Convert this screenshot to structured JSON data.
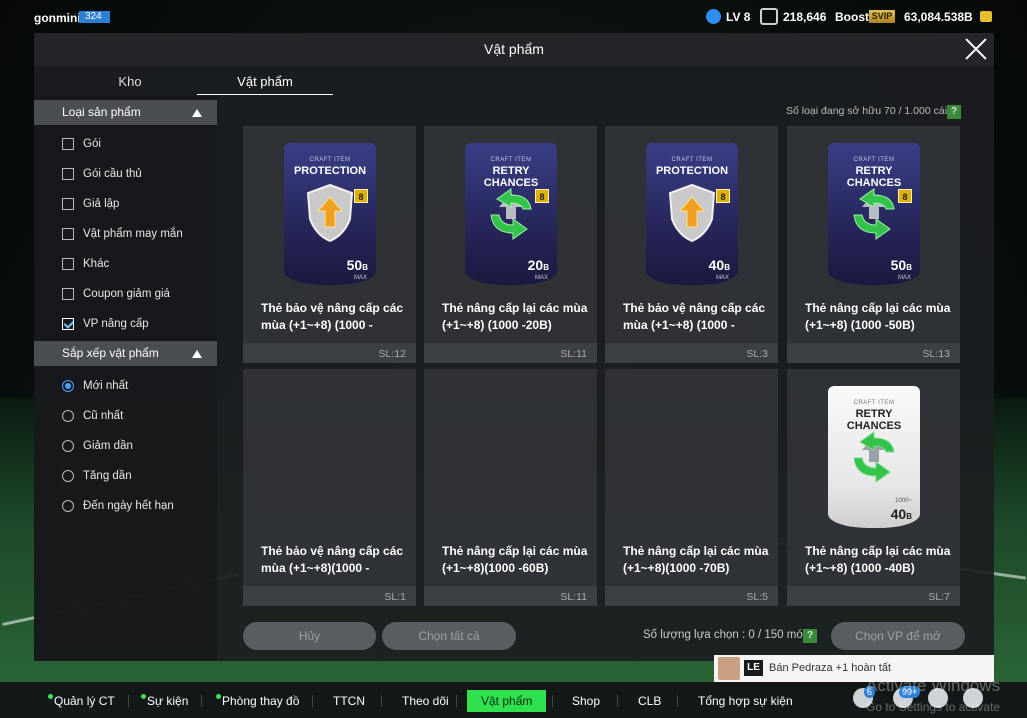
{
  "user": {
    "name": "gonmini",
    "badge": "324"
  },
  "status": {
    "level": "LV 8",
    "coins": "218,646",
    "boost_label": "Boost",
    "svip_label": "SVIP",
    "bp": "63,084.538B"
  },
  "modal": {
    "title": "Vật phẩm",
    "tabs": [
      {
        "label": "Kho"
      },
      {
        "label": "Vật phẩm"
      }
    ]
  },
  "sidebar": {
    "product_type": {
      "header": "Loại sản phẩm",
      "items": [
        {
          "label": "Gói",
          "checked": false
        },
        {
          "label": "Gói cầu thủ",
          "checked": false
        },
        {
          "label": "Giả lập",
          "checked": false
        },
        {
          "label": "Vật phẩm may mắn",
          "checked": false
        },
        {
          "label": "Khác",
          "checked": false
        },
        {
          "label": "Coupon giảm giá",
          "checked": false
        },
        {
          "label": "VP nâng cấp",
          "checked": true
        }
      ]
    },
    "sort": {
      "header": "Sắp xếp vật phẩm",
      "items": [
        {
          "label": "Mới nhất",
          "selected": true
        },
        {
          "label": "Cũ nhất",
          "selected": false
        },
        {
          "label": "Giảm dần",
          "selected": false
        },
        {
          "label": "Tăng dần",
          "selected": false
        },
        {
          "label": "Đến ngày hết hạn",
          "selected": false
        }
      ]
    }
  },
  "inventory": {
    "count_text": "Số loại đang sở hữu  70 / 1.000 cái",
    "help": "?"
  },
  "cards": [
    {
      "sub": "CRAFT ITEM",
      "title": "PROTECTION",
      "level": "8",
      "value": "50",
      "unit": "B",
      "max": "MAX",
      "name": "Thẻ bảo vệ nâng cấp các mùa (+1~+8) (1000 -",
      "sl": "SL:12",
      "style": "dark"
    },
    {
      "sub": "CRAFT ITEM",
      "title": "RETRY CHANCES",
      "level": "8",
      "value": "20",
      "unit": "B",
      "max": "MAX",
      "name": "Thẻ nâng cấp lại các mùa (+1~+8) (1000 -20B)",
      "sl": "SL:11",
      "style": "dark"
    },
    {
      "sub": "CRAFT ITEM",
      "title": "PROTECTION",
      "level": "8",
      "value": "40",
      "unit": "B",
      "max": "MAX",
      "name": "Thẻ bảo vệ nâng cấp các mùa (+1~+8) (1000 -",
      "sl": "SL:3",
      "style": "dark"
    },
    {
      "sub": "CRAFT ITEM",
      "title": "RETRY CHANCES",
      "level": "8",
      "value": "50",
      "unit": "B",
      "max": "MAX",
      "name": "Thẻ nâng cấp lại các mùa (+1~+8) (1000 -50B)",
      "sl": "SL:13",
      "style": "dark"
    },
    {
      "name": "Thẻ bảo vệ nâng cấp các mùa (+1~+8)(1000 -",
      "sl": "SL:1",
      "style": "none"
    },
    {
      "name": "Thẻ nâng cấp lại các mùa (+1~+8)(1000 -60B)",
      "sl": "SL:11",
      "style": "none"
    },
    {
      "name": "Thẻ nâng cấp lại các mùa (+1~+8)(1000 -70B)",
      "sl": "SL:5",
      "style": "none"
    },
    {
      "sub": "CRAFT ITEM",
      "title": "RETRY CHANCES",
      "value": "40",
      "unit": "B",
      "max": "1000~",
      "name": "Thẻ nâng cấp lại các mùa (+1~+8) (1000 -40B)",
      "sl": "SL:7",
      "style": "white"
    }
  ],
  "footer": {
    "cancel_label": "Hủy",
    "select_all_label": "Chọn tất cả",
    "selection_count": "Số lượng lựa chọn : 0 / 150 món",
    "help": "?",
    "select_vp_label": "Chọn VP để mở"
  },
  "notification": {
    "badge": "LE",
    "text": "Bán Pedraza +1 hoàn tất"
  },
  "bottom_nav": [
    {
      "label": "Quản lý CT",
      "dot": true
    },
    {
      "label": "Sự kiện",
      "dot": true
    },
    {
      "label": "Phòng thay đồ",
      "dot": true
    },
    {
      "label": "TTCN",
      "dot": false
    },
    {
      "label": "Theo dõi",
      "dot": false
    },
    {
      "label": "Vật phẩm",
      "dot": false,
      "active": true
    },
    {
      "label": "Shop",
      "dot": false
    },
    {
      "label": "CLB",
      "dot": false
    },
    {
      "label": "Tổng hợp sự kiện",
      "dot": false
    }
  ],
  "nav_badges": {
    "home": "6",
    "friends": "99+"
  },
  "watermark": {
    "line1": "Activate Windows",
    "line2": "Go to Settings to activate"
  },
  "colors": {
    "accent_green": "#2fe04f",
    "check_blue": "#4aa3ff",
    "level_badge": "#2b7fd4"
  }
}
